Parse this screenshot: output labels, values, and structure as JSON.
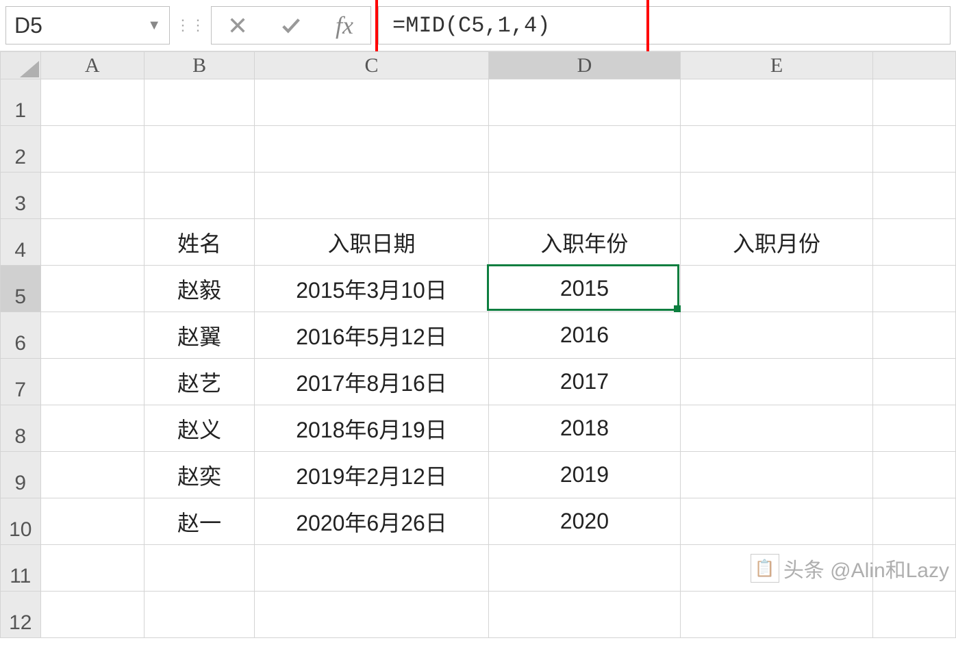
{
  "nameBox": "D5",
  "formula": "=MID(C5,1,4)",
  "fxLabel": "fx",
  "columns": [
    "A",
    "B",
    "C",
    "D",
    "E"
  ],
  "activeCol": "D",
  "activeRow": 5,
  "rows": [
    {
      "n": 1,
      "A": "",
      "B": "",
      "C": "",
      "D": "",
      "E": ""
    },
    {
      "n": 2,
      "A": "",
      "B": "",
      "C": "",
      "D": "",
      "E": ""
    },
    {
      "n": 3,
      "A": "",
      "B": "",
      "C": "",
      "D": "",
      "E": ""
    },
    {
      "n": 4,
      "A": "",
      "B": "姓名",
      "C": "入职日期",
      "D": "入职年份",
      "E": "入职月份"
    },
    {
      "n": 5,
      "A": "",
      "B": "赵毅",
      "C": "2015年3月10日",
      "D": "2015",
      "E": ""
    },
    {
      "n": 6,
      "A": "",
      "B": "赵翼",
      "C": "2016年5月12日",
      "D": "2016",
      "E": ""
    },
    {
      "n": 7,
      "A": "",
      "B": "赵艺",
      "C": "2017年8月16日",
      "D": "2017",
      "E": ""
    },
    {
      "n": 8,
      "A": "",
      "B": "赵义",
      "C": "2018年6月19日",
      "D": "2018",
      "E": ""
    },
    {
      "n": 9,
      "A": "",
      "B": "赵奕",
      "C": "2019年2月12日",
      "D": "2019",
      "E": ""
    },
    {
      "n": 10,
      "A": "",
      "B": "赵一",
      "C": "2020年6月26日",
      "D": "2020",
      "E": ""
    },
    {
      "n": 11,
      "A": "",
      "B": "",
      "C": "",
      "D": "",
      "E": ""
    },
    {
      "n": 12,
      "A": "",
      "B": "",
      "C": "",
      "D": "",
      "E": ""
    }
  ],
  "watermark": "头条 @Alin和Lazy"
}
